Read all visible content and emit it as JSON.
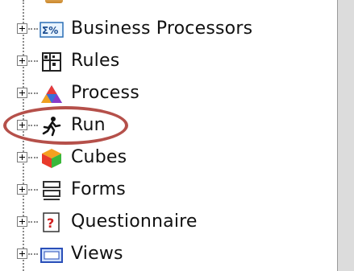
{
  "tree": {
    "items": [
      {
        "label": "Business Processors",
        "icon": "business-processors-icon"
      },
      {
        "label": "Rules",
        "icon": "rules-icon"
      },
      {
        "label": "Process",
        "icon": "process-icon"
      },
      {
        "label": "Run",
        "icon": "run-icon"
      },
      {
        "label": "Cubes",
        "icon": "cubes-icon"
      },
      {
        "label": "Forms",
        "icon": "forms-icon"
      },
      {
        "label": "Questionnaire",
        "icon": "questionnaire-icon"
      },
      {
        "label": "Views",
        "icon": "views-icon"
      }
    ]
  },
  "annotation": {
    "color": "#b5504a",
    "target": "Run"
  }
}
